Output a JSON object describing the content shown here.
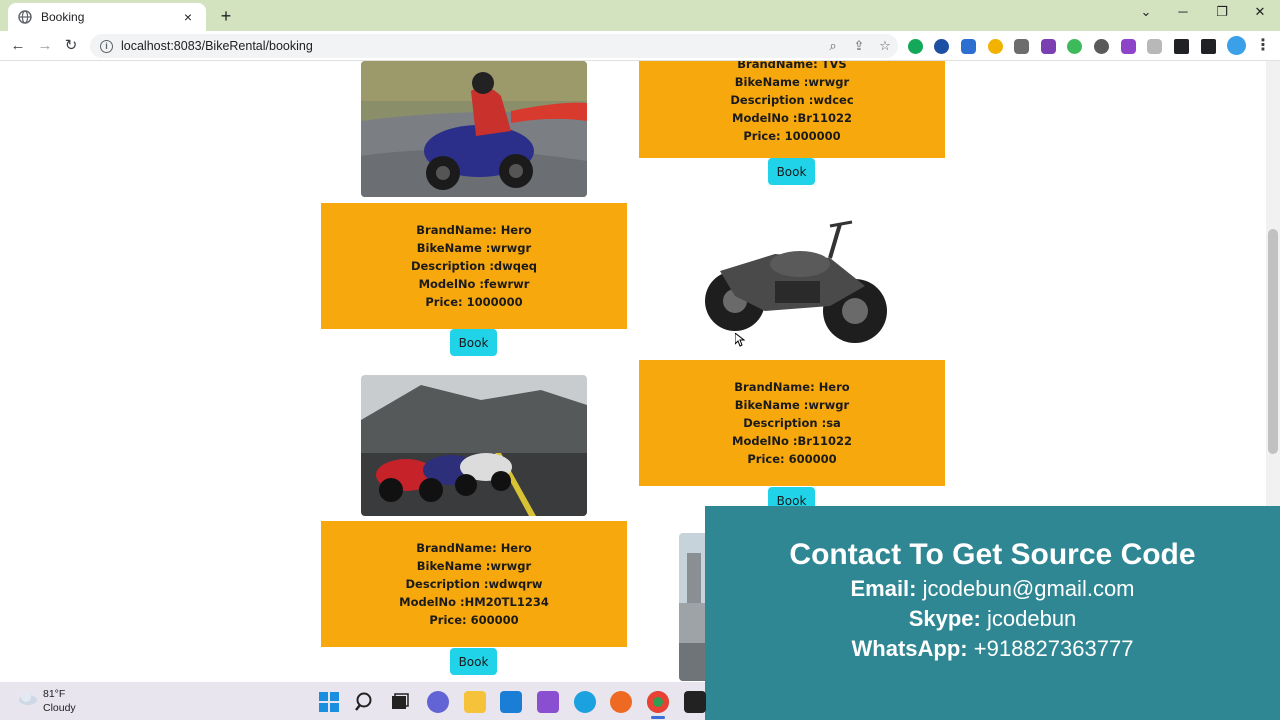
{
  "browser": {
    "tab_title": "Booking",
    "tab_close": "×",
    "new_tab": "+",
    "url": "localhost:8083/BikeRental/booking",
    "win_minimize": "─",
    "win_restore": "❐",
    "win_close": "✕",
    "win_chevron": "⌄"
  },
  "bikes": [
    {
      "brand": "TVS",
      "bike_name": "wrwgr",
      "description": "wdcec",
      "model_no": "Br11022",
      "price": "1000000",
      "book_label": "Book"
    },
    {
      "brand": "Hero",
      "bike_name": "wrwgr",
      "description": "dwqeq",
      "model_no": "fewrwr",
      "price": "1000000",
      "book_label": "Book"
    },
    {
      "brand": "Hero",
      "bike_name": "wrwgr",
      "description": "sa",
      "model_no": "Br11022",
      "price": "600000",
      "book_label": "Book"
    },
    {
      "brand": "Hero",
      "bike_name": "wrwgr",
      "description": "wdwqrw",
      "model_no": "HM20TL1234",
      "price": "600000",
      "book_label": "Book"
    }
  ],
  "labels": {
    "brand": "BrandName: ",
    "bike_name": "BikeName :",
    "description": "Description :",
    "model_no": "ModelNo :",
    "price": "Price: "
  },
  "banner": {
    "title": "Contact To Get Source Code",
    "email_label": "Email:",
    "email": "jcodebun@gmail.com",
    "skype_label": "Skype:",
    "skype": "jcodebun",
    "whatsapp_label": "WhatsApp:",
    "whatsapp": "+918827363777"
  },
  "taskbar": {
    "temperature": "81°F",
    "weather": "Cloudy"
  },
  "colors": {
    "card": "#f7a80d",
    "button": "#20d3e8",
    "banner": "#2f8793",
    "tabbar": "#d3e3c0"
  }
}
